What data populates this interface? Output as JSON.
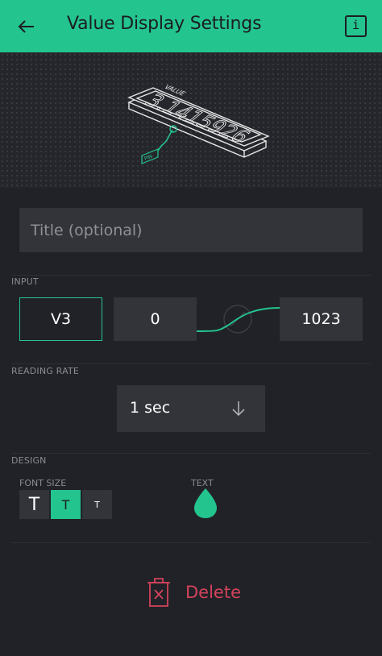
{
  "header": {
    "title": "Value Display Settings",
    "back_icon": "back-arrow-icon",
    "info_label": "i"
  },
  "preview": {
    "widget_label": "VALUE",
    "widget_value": "3.1415926",
    "pin_label": "PIN"
  },
  "title_field": {
    "placeholder": "Title (optional)",
    "value": ""
  },
  "input": {
    "section_label": "INPUT",
    "pin": "V3",
    "min": "0",
    "max": "1023"
  },
  "reading_rate": {
    "section_label": "READING RATE",
    "value": "1 sec",
    "dropdown_icon": "arrow-down-icon"
  },
  "design": {
    "section_label": "DESIGN",
    "font_size_label": "FONT SIZE",
    "font_sizes": [
      "T",
      "T",
      "T"
    ],
    "selected_font_size": 1,
    "text_label": "TEXT",
    "text_color": "#23c48e"
  },
  "delete": {
    "label": "Delete",
    "icon": "trash-icon"
  },
  "colors": {
    "accent": "#23c48e",
    "background": "#212227",
    "field": "#33343a",
    "danger": "#d3435c"
  }
}
